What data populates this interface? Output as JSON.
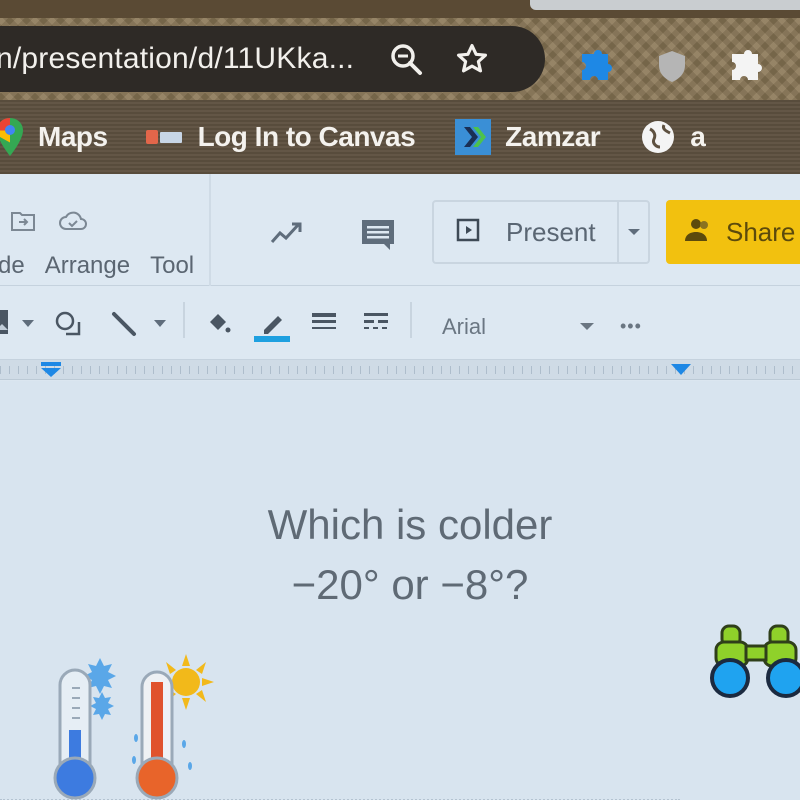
{
  "browser": {
    "url_text": "n/presentation/d/11UKka...",
    "omnibox_icons": [
      "zoom-out-icon",
      "bookmark-star-icon"
    ],
    "extensions": [
      {
        "name": "puzzle-extension",
        "color": "#1e88e5"
      },
      {
        "name": "shield-extension",
        "color": "#b9b9b9"
      },
      {
        "name": "extensions-puzzle",
        "color": "#f4f4f4"
      }
    ],
    "bookmarks": [
      {
        "label": "Maps",
        "icon": "google-maps-icon"
      },
      {
        "label": "Log In to Canvas",
        "icon": "canvas-icon"
      },
      {
        "label": "Zamzar",
        "icon": "zamzar-icon"
      },
      {
        "label": "a",
        "icon": "globe-icon"
      }
    ]
  },
  "slides": {
    "menus": [
      "de",
      "Arrange",
      "Tool"
    ],
    "present_label": "Present",
    "share_label": "Share",
    "share_color": "#f2c10f",
    "font_name": "Arial",
    "more_label": "•••",
    "highlight_color": "#1ea0e0"
  },
  "slide": {
    "question_line1": "Which is colder",
    "question_line2": "−20° or −8°?",
    "images": [
      "cold-thermometer-snowflake",
      "hot-thermometer-sun",
      "binoculars"
    ]
  }
}
